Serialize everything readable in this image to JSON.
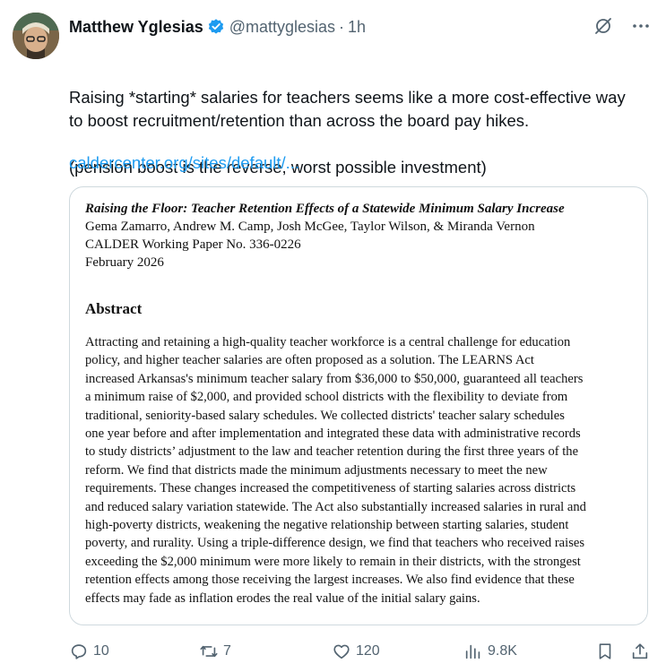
{
  "tweet": {
    "author_name": "Matthew Yglesias",
    "handle": "@mattyglesias",
    "separator": "·",
    "timestamp": "1h",
    "text_lines": [
      "Raising *starting* salaries for teachers seems like a more cost-effective way",
      "to boost recruitment/retention than across the board pay hikes."
    ],
    "text_line_2": "(pension boost is the reverse, worst possible investment)",
    "link": "caldercenter.org/sites/default/...",
    "top_icons": [
      "grok-icon",
      "more-icon"
    ],
    "more_label": "···"
  },
  "card": {
    "title": "Raising the Floor: Teacher Retention Effects of a Statewide Minimum Salary Increase",
    "authors": "Gema Zamarro, Andrew M. Camp, Josh McGee, Taylor Wilson, & Miranda Vernon",
    "series": "CALDER Working Paper No. 336-0226",
    "date": "February 2026",
    "abstract_heading": "Abstract",
    "abstract_lines": [
      "Attracting and retaining a high-quality teacher workforce is a central challenge for education",
      "policy, and higher teacher salaries are often proposed as a solution. The LEARNS Act",
      "increased Arkansas's minimum teacher salary from $36,000 to $50,000, guaranteed all teachers",
      "a minimum raise of $2,000, and provided school districts with the flexibility to deviate from",
      "traditional, seniority-based salary schedules. We collected districts' teacher salary schedules",
      "one year before and after implementation and integrated these data with administrative records",
      "to study districts’ adjustment to the law and teacher retention during the first three years of the",
      "reform. We find that districts made the minimum adjustments necessary to meet the new",
      "requirements. These changes increased the competitiveness of starting salaries across districts",
      "and reduced salary variation statewide. The Act also substantially increased salaries in rural and",
      "high-poverty districts, weakening the negative relationship between starting salaries, student",
      "poverty, and rurality. Using a triple-difference design, we find that teachers who received raises",
      "exceeding the $2,000 minimum were more likely to remain in their districts, with the strongest",
      "retention effects among those receiving the largest increases. We also find evidence that these",
      "effects may fade as inflation erodes the real value of the initial salary gains."
    ]
  },
  "actions": {
    "replies": "10",
    "reposts": "7",
    "likes": "120",
    "views": "9.8K",
    "icons": [
      "reply-icon",
      "repost-icon",
      "like-icon",
      "views-icon",
      "bookmark-icon",
      "share-icon"
    ]
  },
  "colors": {
    "accent": "#1d9bf0",
    "secondary_text": "#536471",
    "primary_text": "#0f1419",
    "border": "#cfd9de"
  }
}
